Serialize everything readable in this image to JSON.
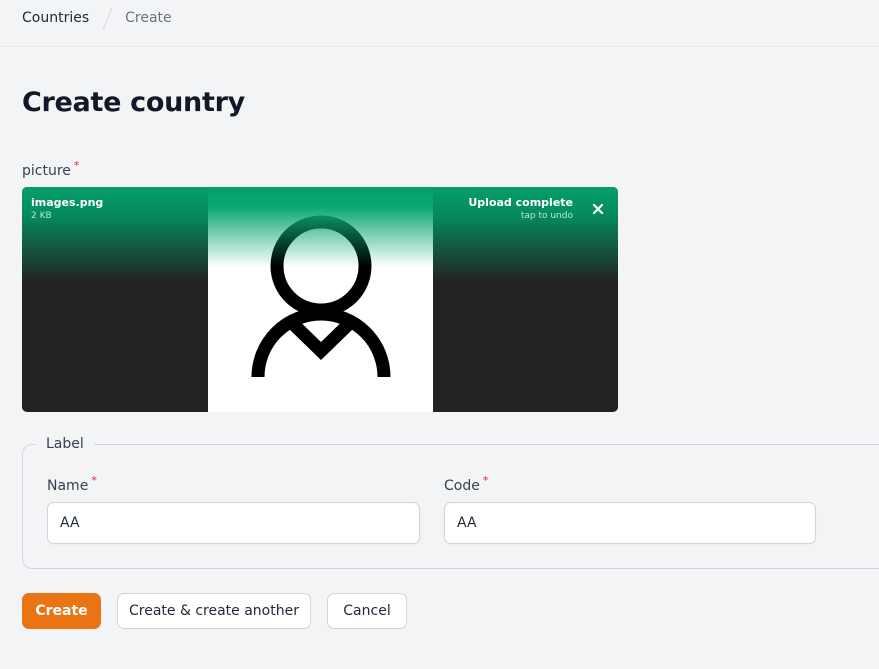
{
  "breadcrumb": {
    "items": [
      "Countries",
      "Create"
    ]
  },
  "page": {
    "title": "Create country"
  },
  "picture": {
    "label": "picture",
    "required_mark": "*",
    "file_name": "images.png",
    "file_size": "2 KB",
    "status": "Upload complete",
    "undo_hint": "tap to undo",
    "close_icon": "close-icon",
    "preview_icon": "user-avatar-icon"
  },
  "label_section": {
    "legend": "Label",
    "name": {
      "label": "Name",
      "required_mark": "*",
      "value": "AA"
    },
    "code": {
      "label": "Code",
      "required_mark": "*",
      "value": "AA"
    }
  },
  "actions": {
    "create": "Create",
    "create_another": "Create & create another",
    "cancel": "Cancel"
  },
  "colors": {
    "primary": "#ea7314",
    "upload_success": "#069e6b",
    "required": "#e11d48"
  }
}
